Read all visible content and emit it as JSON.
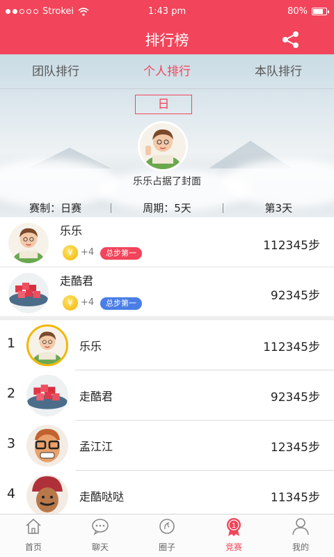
{
  "status_bar": {
    "carrier": "Strokei",
    "time": "1:43 pm",
    "battery": "80%",
    "battery_level": 0.8
  },
  "header": {
    "title": "排行榜",
    "share_icon": "share-icon"
  },
  "tabs": [
    {
      "label": "团队排行",
      "active": false
    },
    {
      "label": "个人排行",
      "active": true
    },
    {
      "label": "本队排行",
      "active": false
    }
  ],
  "period": {
    "label": "日"
  },
  "cover": {
    "caption": "乐乐占据了封面"
  },
  "meta": {
    "format": "赛制：日赛",
    "cycle": "周期：5天",
    "day": "第3天"
  },
  "highlights": [
    {
      "name": "乐乐",
      "coin": "¥",
      "bonus": "+4",
      "badge": "总步第一",
      "badge_color": "#f2445a",
      "steps": "112345步"
    },
    {
      "name": "走酷君",
      "coin": "¥",
      "bonus": "+4",
      "badge": "总步第一",
      "badge_color": "#4a7ee6",
      "steps": "92345步"
    }
  ],
  "ranking": [
    {
      "rank": "1",
      "name": "乐乐",
      "steps": "112345步"
    },
    {
      "rank": "2",
      "name": "走酷君",
      "steps": "92345步"
    },
    {
      "rank": "3",
      "name": "孟江江",
      "steps": "12345步"
    },
    {
      "rank": "4",
      "name": "走酷哒哒",
      "steps": "11345步"
    }
  ],
  "bottom_nav": [
    {
      "label": "首页",
      "icon": "home-icon",
      "active": false
    },
    {
      "label": "聊天",
      "icon": "chat-icon",
      "active": false
    },
    {
      "label": "圈子",
      "icon": "circle-icon",
      "active": false
    },
    {
      "label": "竞赛",
      "icon": "medal-icon",
      "active": true
    },
    {
      "label": "我的",
      "icon": "profile-icon",
      "active": false
    }
  ],
  "colors": {
    "accent": "#f2445a",
    "gold": "#f2b600",
    "blue_badge": "#4a7ee6"
  }
}
